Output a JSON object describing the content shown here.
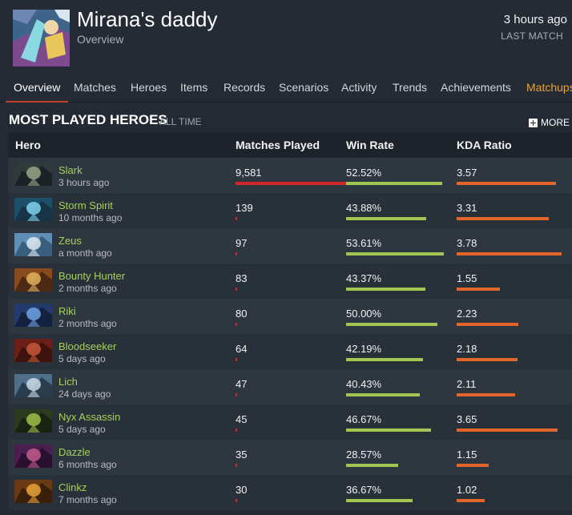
{
  "profile": {
    "name": "Mirana's daddy",
    "subtitle": "Overview",
    "last_match_time": "3 hours ago",
    "last_match_label": "LAST MATCH"
  },
  "tabs": [
    {
      "label": "Overview",
      "active": true
    },
    {
      "label": "Matches"
    },
    {
      "label": "Heroes"
    },
    {
      "label": "Items"
    },
    {
      "label": "Records"
    },
    {
      "label": "Scenarios"
    },
    {
      "label": "Activity"
    },
    {
      "label": "Trends"
    },
    {
      "label": "Achievements"
    },
    {
      "label": "Matchups",
      "accent": true
    }
  ],
  "section": {
    "title": "MOST PLAYED HEROES",
    "subtitle": "ALL TIME",
    "more_label": "MORE"
  },
  "table": {
    "headers": {
      "hero": "Hero",
      "matches": "Matches Played",
      "winrate": "Win Rate",
      "kda": "KDA Ratio"
    },
    "rows": [
      {
        "hero": "Slark",
        "time": "3 hours ago",
        "matches": "9,581",
        "winrate": "52.52%",
        "kda": "3.57",
        "matches_frac": 1.0,
        "win_frac": 0.9195,
        "kda_frac": 0.9444,
        "palette": [
          "#2f3a3a",
          "#9aa48a",
          "#1c2326"
        ]
      },
      {
        "hero": "Storm Spirit",
        "time": "10 months ago",
        "matches": "139",
        "winrate": "43.88%",
        "kda": "3.31",
        "matches_frac": 0.0145,
        "win_frac": 0.7682,
        "kda_frac": 0.8757,
        "palette": [
          "#1d4f6b",
          "#7fd3ec",
          "#173446"
        ]
      },
      {
        "hero": "Zeus",
        "time": "a month ago",
        "matches": "97",
        "winrate": "53.61%",
        "kda": "3.78",
        "matches_frac": 0.0101,
        "win_frac": 0.9386,
        "kda_frac": 1.0,
        "palette": [
          "#5f8fb5",
          "#dfe9f2",
          "#3a5e7d"
        ]
      },
      {
        "hero": "Bounty Hunter",
        "time": "2 months ago",
        "matches": "83",
        "winrate": "43.37%",
        "kda": "1.55",
        "matches_frac": 0.0087,
        "win_frac": 0.7593,
        "kda_frac": 0.4101,
        "palette": [
          "#8a4a1e",
          "#e0b25c",
          "#4e2a14"
        ]
      },
      {
        "hero": "Riki",
        "time": "2 months ago",
        "matches": "80",
        "winrate": "50.00%",
        "kda": "2.23",
        "matches_frac": 0.0083,
        "win_frac": 0.8754,
        "kda_frac": 0.5899,
        "palette": [
          "#233a6c",
          "#6fa2e3",
          "#15223f"
        ]
      },
      {
        "hero": "Bloodseeker",
        "time": "5 days ago",
        "matches": "64",
        "winrate": "42.19%",
        "kda": "2.18",
        "matches_frac": 0.0067,
        "win_frac": 0.7386,
        "kda_frac": 0.5767,
        "palette": [
          "#6b1f16",
          "#c4583a",
          "#3e120d"
        ]
      },
      {
        "hero": "Lich",
        "time": "24 days ago",
        "matches": "47",
        "winrate": "40.43%",
        "kda": "2.11",
        "matches_frac": 0.0049,
        "win_frac": 0.7078,
        "kda_frac": 0.5582,
        "palette": [
          "#4f6f88",
          "#c9dbe6",
          "#2a3d4d"
        ]
      },
      {
        "hero": "Nyx Assassin",
        "time": "5 days ago",
        "matches": "45",
        "winrate": "46.67%",
        "kda": "3.65",
        "matches_frac": 0.0047,
        "win_frac": 0.8171,
        "kda_frac": 0.9656,
        "palette": [
          "#2c3a1e",
          "#9fbf4a",
          "#1a2212"
        ]
      },
      {
        "hero": "Dazzle",
        "time": "6 months ago",
        "matches": "35",
        "winrate": "28.57%",
        "kda": "1.15",
        "matches_frac": 0.0037,
        "win_frac": 0.5002,
        "kda_frac": 0.3042,
        "palette": [
          "#4a1f4f",
          "#c15a8c",
          "#2a1030"
        ]
      },
      {
        "hero": "Clinkz",
        "time": "7 months ago",
        "matches": "30",
        "winrate": "36.67%",
        "kda": "1.02",
        "matches_frac": 0.0031,
        "win_frac": 0.642,
        "kda_frac": 0.2698,
        "palette": [
          "#6a3a14",
          "#e8a33a",
          "#3a1f0b"
        ]
      }
    ]
  },
  "colors": {
    "background": "#232a33",
    "hero_link": "#a5d15a",
    "matches_bar": "#d0272f",
    "winrate_bar": "#a2c654",
    "kda_bar": "#e2652c",
    "active_tab_underline": "#c23c2a",
    "accent_tab": "#e8a33a"
  }
}
